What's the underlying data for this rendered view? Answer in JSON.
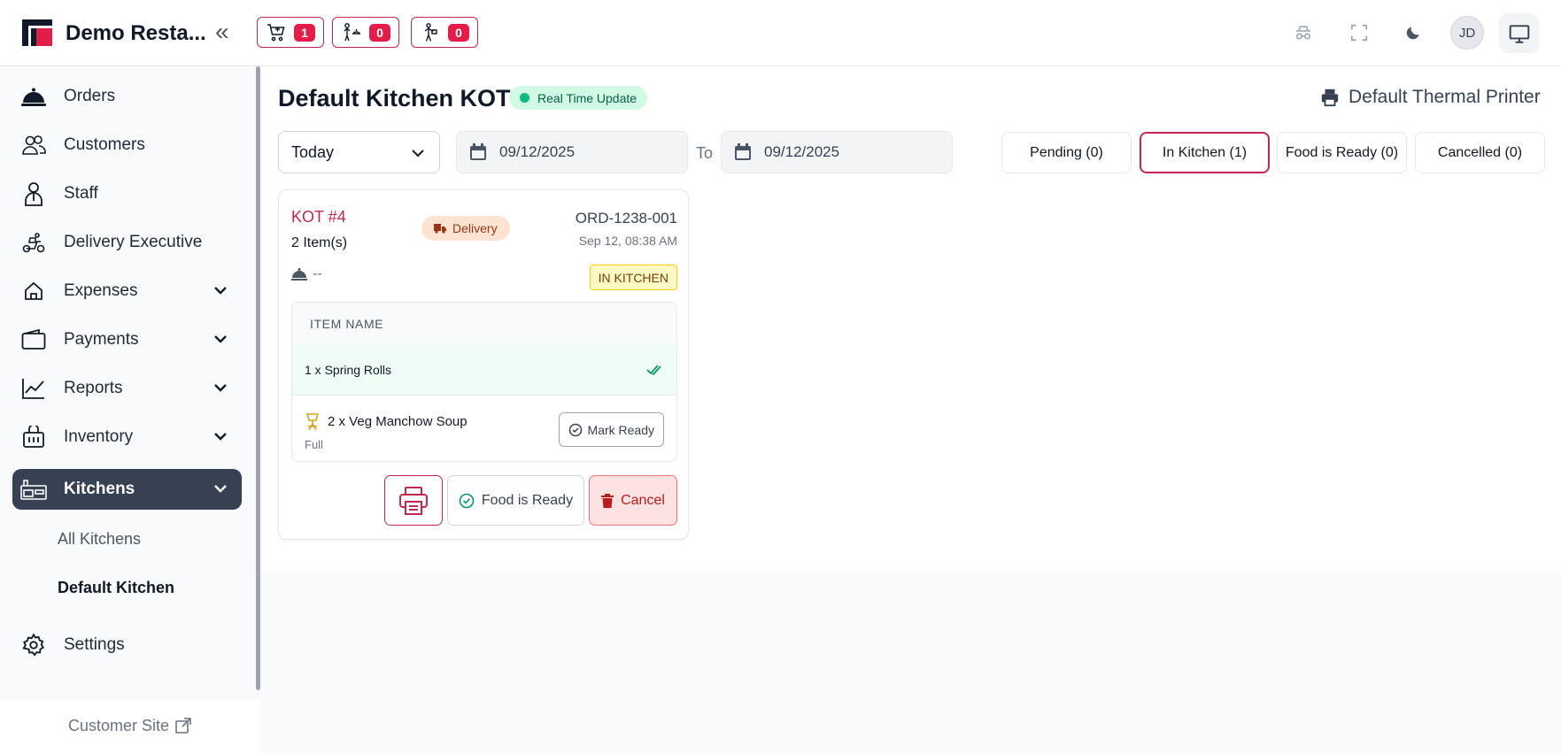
{
  "header": {
    "brand": "Demo Resta...",
    "badges": [
      {
        "icon": "cart-icon",
        "count": "1"
      },
      {
        "icon": "waiter-icon",
        "count": "0"
      },
      {
        "icon": "delivery-person-icon",
        "count": "0"
      }
    ],
    "avatar_initials": "JD"
  },
  "sidebar": {
    "items": [
      {
        "label": "Orders",
        "icon": "cloche-icon"
      },
      {
        "label": "Customers",
        "icon": "users-icon"
      },
      {
        "label": "Staff",
        "icon": "staff-icon"
      },
      {
        "label": "Delivery Executive",
        "icon": "scooter-icon"
      },
      {
        "label": "Expenses",
        "icon": "home-icon"
      },
      {
        "label": "Payments",
        "icon": "wallet-icon"
      },
      {
        "label": "Reports",
        "icon": "chart-line-icon"
      },
      {
        "label": "Inventory",
        "icon": "basket-icon"
      },
      {
        "label": "Kitchens",
        "icon": "kitchen-icon"
      },
      {
        "label": "Settings",
        "icon": "gear-icon"
      }
    ],
    "sub_items": [
      "All Kitchens",
      "Default Kitchen"
    ],
    "customer_site": "Customer Site"
  },
  "main": {
    "title": "Default Kitchen KOT",
    "realtime_badge": "Real Time Update",
    "printer": "Default Thermal Printer",
    "filter": {
      "period": "Today",
      "from_date": "09/12/2025",
      "to_label": "To",
      "to_date": "09/12/2025"
    },
    "tabs": [
      {
        "label": "Pending (0)"
      },
      {
        "label": "In Kitchen (1)"
      },
      {
        "label": "Food is Ready (0)"
      },
      {
        "label": "Cancelled (0)"
      }
    ],
    "selected_tab": "In Kitchen (1)"
  },
  "kot_card": {
    "kot_number": "KOT #4",
    "item_count": "2 Item(s)",
    "order_type": "Delivery",
    "order_id": "ORD-1238-001",
    "order_time": "Sep 12, 08:38 AM",
    "waiter": "--",
    "status": "IN KITCHEN",
    "table_header": "ITEM NAME",
    "items": [
      {
        "name": "1 x Spring Rolls",
        "state": "ready"
      },
      {
        "name": "2 x Veg Manchow Soup",
        "variant": "Full",
        "state": "cooking"
      }
    ],
    "mark_ready_label": "Mark Ready",
    "food_ready_label": "Food is Ready",
    "cancel_label": "Cancel"
  },
  "colors": {
    "accent": "#c0294f",
    "sidebar_active": "#374151",
    "realtime_green": "#10b981",
    "status_yellow": "#fef9c3"
  }
}
